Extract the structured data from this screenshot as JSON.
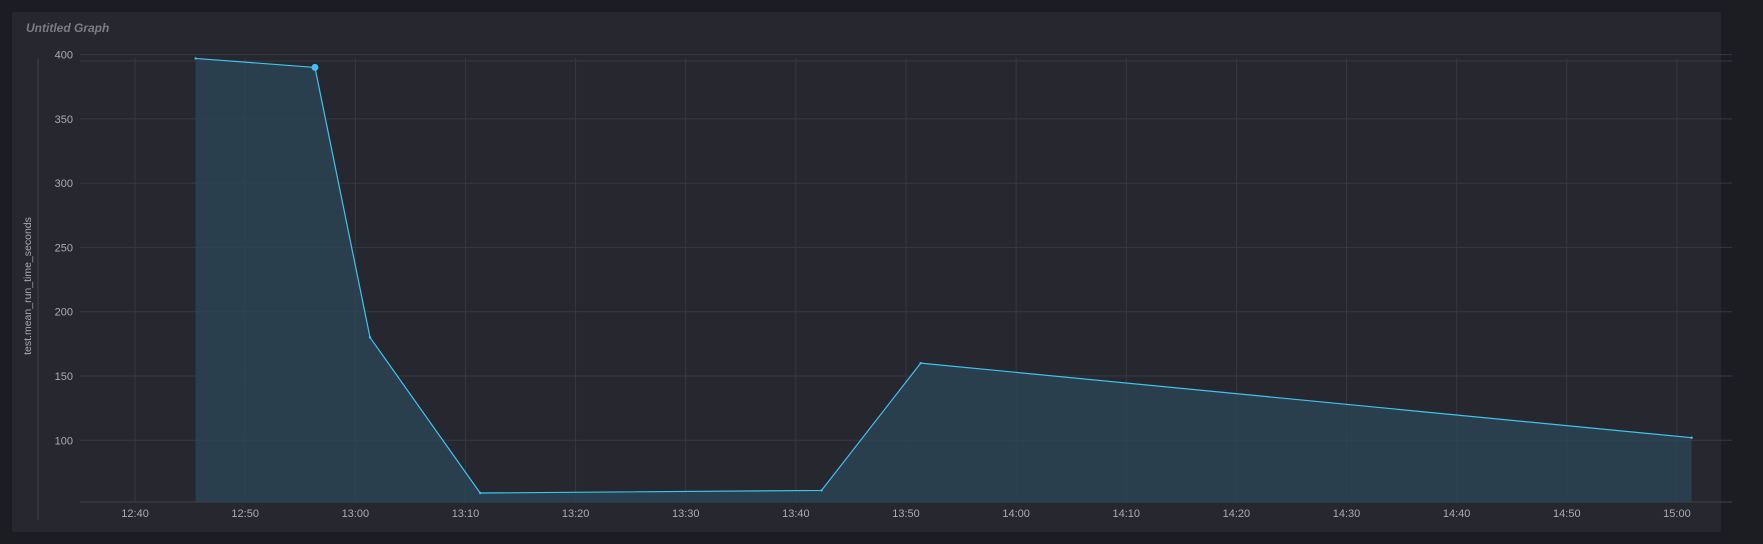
{
  "panel": {
    "title": "Untitled Graph"
  },
  "colors": {
    "background": "#1c1d23",
    "panel": "#26272f",
    "grid": "#363843",
    "line": "#3ec4ee",
    "fill": "#2a4454"
  },
  "chart_data": {
    "type": "area",
    "title": "Untitled Graph",
    "xlabel": "",
    "ylabel": "test.mean_run_time_seconds",
    "x_ticks": [
      "12:40",
      "12:50",
      "13:00",
      "13:10",
      "13:20",
      "13:30",
      "13:40",
      "13:50",
      "14:00",
      "14:10",
      "14:20",
      "14:30",
      "14:40",
      "14:50",
      "15:00"
    ],
    "y_ticks": [
      100,
      150,
      200,
      250,
      300,
      350,
      400
    ],
    "xlim": [
      "12:35",
      "15:05"
    ],
    "ylim": [
      52,
      402
    ],
    "grid": true,
    "series": [
      {
        "x": [
          "12:45:30",
          "12:56:20",
          "13:01:20",
          "13:11:20",
          "13:42:20",
          "13:51:20",
          "15:01:20"
        ],
        "values": [
          397,
          390,
          180,
          59,
          61,
          160,
          102
        ]
      }
    ],
    "highlighted_point": {
      "x": "12:56:20",
      "value": 390
    }
  }
}
